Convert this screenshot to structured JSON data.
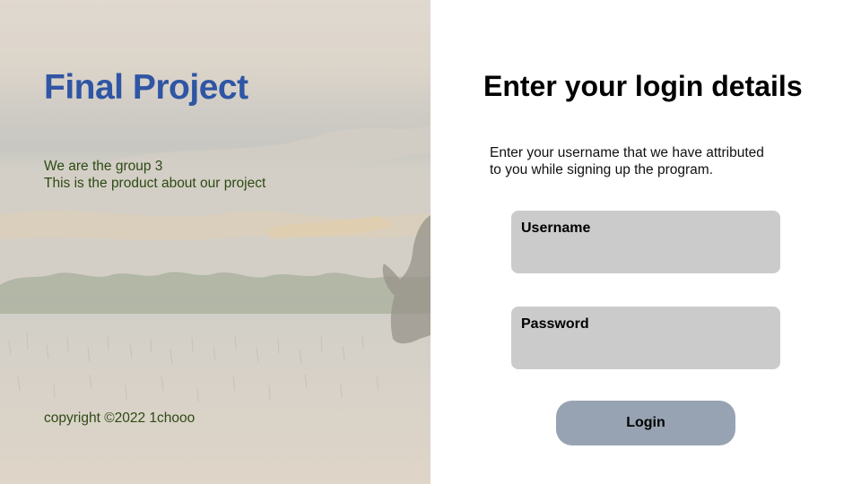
{
  "hero": {
    "title": "Final Project",
    "description_lines": [
      "We are the group 3",
      "This is the product about our project"
    ],
    "copyright": "copyright ©2022 1chooo",
    "background_image": "lakeside-sunset-with-water-buffalo"
  },
  "login": {
    "heading": "Enter your login details",
    "instructions_lines": [
      "Enter your username that we have attributed",
      "to you while signing up the program."
    ],
    "username_label": "Username",
    "username_value": "",
    "password_label": "Password",
    "password_value": "",
    "button_label": "Login"
  },
  "colors": {
    "title_blue": "#2f55a4",
    "hero_text_green": "#2e4a14",
    "field_gray": "#cbcbcb",
    "button_slate": "#97a3b2"
  }
}
